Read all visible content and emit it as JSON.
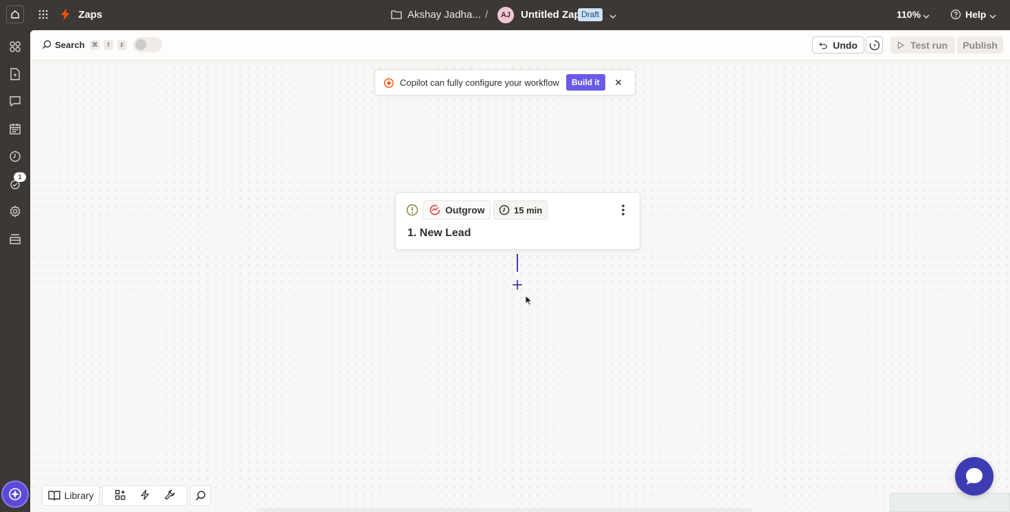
{
  "topbar": {
    "brand": "Zaps",
    "owner": "Akshay Jadha...",
    "separator": "/",
    "avatar_initials": "AJ",
    "zap_title": "Untitled Zap",
    "status_badge": "Draft",
    "zoom": "110%",
    "help": "Help"
  },
  "leftnav": {
    "items": [
      "apps-icon",
      "zap-file-icon",
      "chat-icon",
      "calendar-icon",
      "history-icon",
      "notifications-icon",
      "settings-icon",
      "layers-icon"
    ],
    "notification_count": "1"
  },
  "toolbar": {
    "search_label": "Search",
    "shortcut_keys": [
      "⌘",
      "⇧",
      "F"
    ],
    "undo_label": "Undo",
    "test_run_label": "Test run",
    "publish_label": "Publish"
  },
  "banner": {
    "text": "Copilot can fully configure your workflow",
    "build_label": "Build it"
  },
  "step": {
    "app_name": "Outgrow",
    "interval": "15 min",
    "title": "1. New Lead"
  },
  "bottom_tools": {
    "library_label": "Library"
  },
  "colors": {
    "chrome": "#3d3735",
    "accent": "#3e3cb3",
    "build_button": "#695be8",
    "brand_orange": "#ff4f00",
    "draft_badge": "#cfe3f7"
  }
}
